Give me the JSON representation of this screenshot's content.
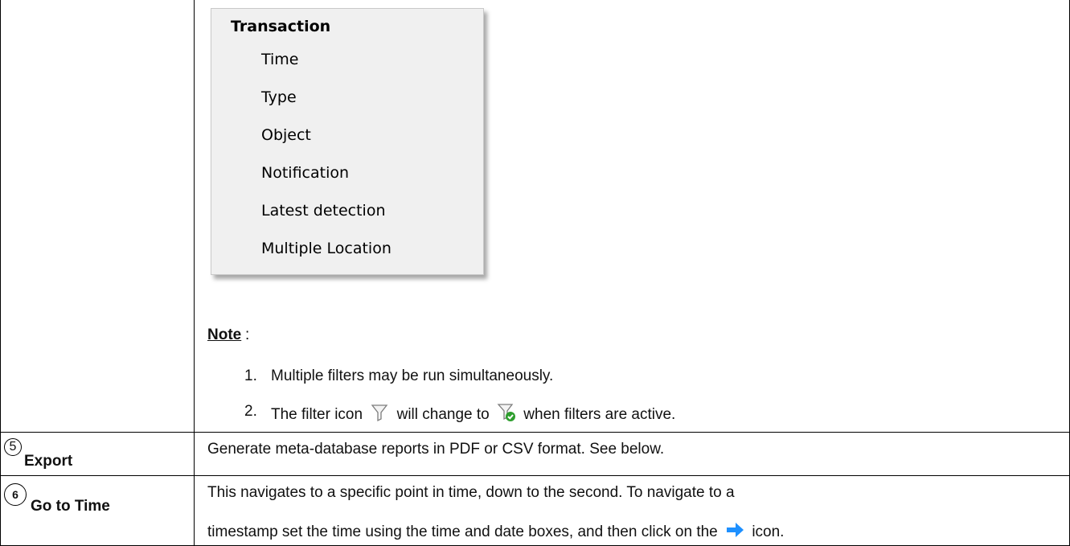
{
  "menu": {
    "header": "Transaction",
    "items": [
      "Time",
      "Type",
      "Object",
      "Notification",
      "Latest detection",
      "Multiple Location"
    ]
  },
  "note": {
    "label": "Note",
    "colon": ":",
    "items": [
      {
        "num": "1.",
        "text": "Multiple filters may be run simultaneously."
      },
      {
        "num": "2.",
        "text_before": "The filter icon",
        "text_middle": "will change to",
        "text_after": "when filters are active."
      }
    ]
  },
  "rows": [
    {
      "number": "5",
      "label": "Export",
      "description": "Generate meta-database reports in PDF or CSV format. See below."
    },
    {
      "number": "6",
      "label": "Go to Time",
      "description_line1": "This navigates to a specific point in time, down to the second. To navigate to a",
      "description_line2_before": "timestamp set the time using the time and date boxes, and then click on the",
      "description_line2_after": "icon."
    }
  ],
  "icons": {
    "filter": "filter-icon",
    "filter_active": "filter-active-icon",
    "go_arrow": "right-arrow-icon"
  },
  "colors": {
    "arrow": "#1e90ff",
    "active_check": "#2e9e2e"
  }
}
